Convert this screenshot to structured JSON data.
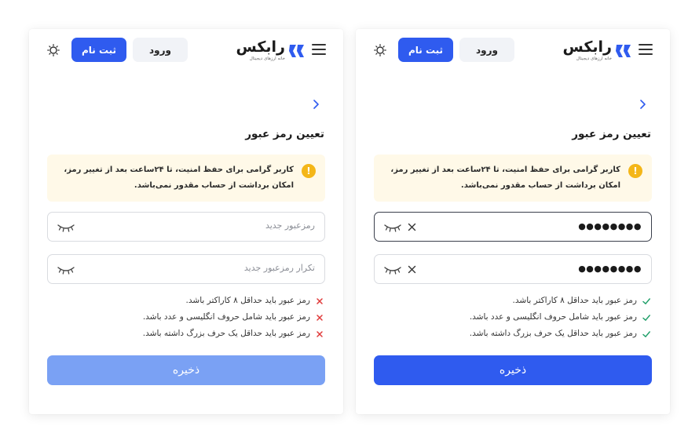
{
  "brand": {
    "name": "رابکس",
    "tagline": "خانه ارزهای دیجیتال",
    "accent": "#2f5bef"
  },
  "header": {
    "signup_label": "ثبت نام",
    "login_label": "ورود"
  },
  "page": {
    "title": "تعیین رمز عبور",
    "notice": "کاربر گرامی برای حفظ امنیت، تا ۲۴ساعت بعد از تغییر رمز، امکان برداشت از حساب مقدور نمی‌باشد.",
    "save_label": "ذخیره"
  },
  "left_panel": {
    "password_placeholder": "رمزعبور جدید",
    "confirm_placeholder": "تکرار رمزعبور جدید",
    "rules": [
      {
        "text": "رمز عبور باید حداقل ۸ کاراکتر باشد.",
        "status": "fail"
      },
      {
        "text": "رمز عبور باید شامل حروف انگلیسی و عدد باشد.",
        "status": "fail"
      },
      {
        "text": "رمز عبور باید حداقل یک حرف بزرگ داشته باشد.",
        "status": "fail"
      }
    ]
  },
  "right_panel": {
    "password_value": "●●●●●●●●",
    "confirm_value": "●●●●●●●●",
    "rules": [
      {
        "text": "رمز عبور باید حداقل ۸ کاراکتر باشد.",
        "status": "pass"
      },
      {
        "text": "رمز عبور باید شامل حروف انگلیسی و عدد باشد.",
        "status": "pass"
      },
      {
        "text": "رمز عبور باید حداقل یک حرف بزرگ داشته باشد.",
        "status": "pass"
      }
    ]
  },
  "icons": {
    "menu": "hamburger-icon",
    "theme": "sun-icon",
    "back": "chevron-right-icon",
    "warning": "exclamation-icon",
    "eye": "eye-closed-icon",
    "clear": "close-icon",
    "fail": "cross-icon",
    "pass": "check-icon"
  },
  "colors": {
    "fail": "#e03a3a",
    "pass": "#22a06b",
    "notice_bg": "#fff9e8",
    "warning": "#f4b618",
    "save_disabled": "#7aa1f4"
  }
}
